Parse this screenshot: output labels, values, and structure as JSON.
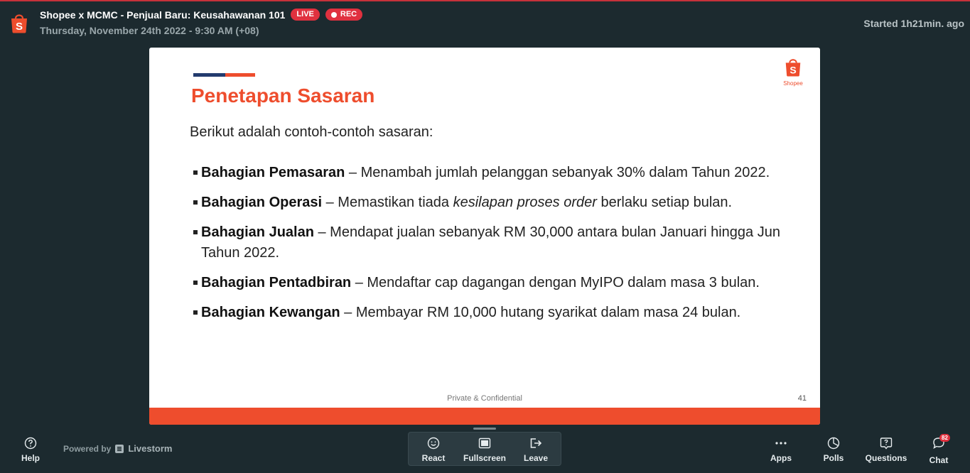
{
  "header": {
    "title": "Shopee x MCMC - Penjual Baru: Keusahawanan 101",
    "live_badge": "LIVE",
    "rec_badge": "REC",
    "date": "Thursday, November 24th 2022 - 9:30 AM (+08)",
    "started": "Started 1h21min. ago"
  },
  "slide": {
    "logo_text": "Shopee",
    "title": "Penetapan Sasaran",
    "intro": "Berikut adalah contoh-contoh sasaran:",
    "bullets": [
      {
        "bold": "Bahagian Pemasaran",
        "text": " – Menambah jumlah pelanggan sebanyak 30% dalam Tahun 2022."
      },
      {
        "bold": "Bahagian Operasi",
        "text_before": " – Memastikan tiada ",
        "italic": "kesilapan proses order",
        "text_after": " berlaku setiap bulan."
      },
      {
        "bold": "Bahagian Jualan",
        "text": " – Mendapat jualan sebanyak RM 30,000 antara bulan Januari  hingga Jun Tahun 2022."
      },
      {
        "bold": "Bahagian Pentadbiran",
        "text": " – Mendaftar cap dagangan dengan MyIPO dalam masa 3  bulan."
      },
      {
        "bold": "Bahagian Kewangan",
        "text": " – Membayar RM 10,000 hutang syarikat dalam masa 24 bulan."
      }
    ],
    "footer": "Private & Confidential",
    "page_number": "41"
  },
  "toolbar": {
    "help": "Help",
    "powered_by": "Powered by",
    "brand": "Livestorm",
    "react": "React",
    "fullscreen": "Fullscreen",
    "leave": "Leave",
    "apps": "Apps",
    "polls": "Polls",
    "questions": "Questions",
    "chat": "Chat",
    "chat_count": "82"
  },
  "colors": {
    "background": "#1c2a2f",
    "accent": "#ee4d2d",
    "badge": "#e0313f",
    "navy": "#233b6e"
  }
}
